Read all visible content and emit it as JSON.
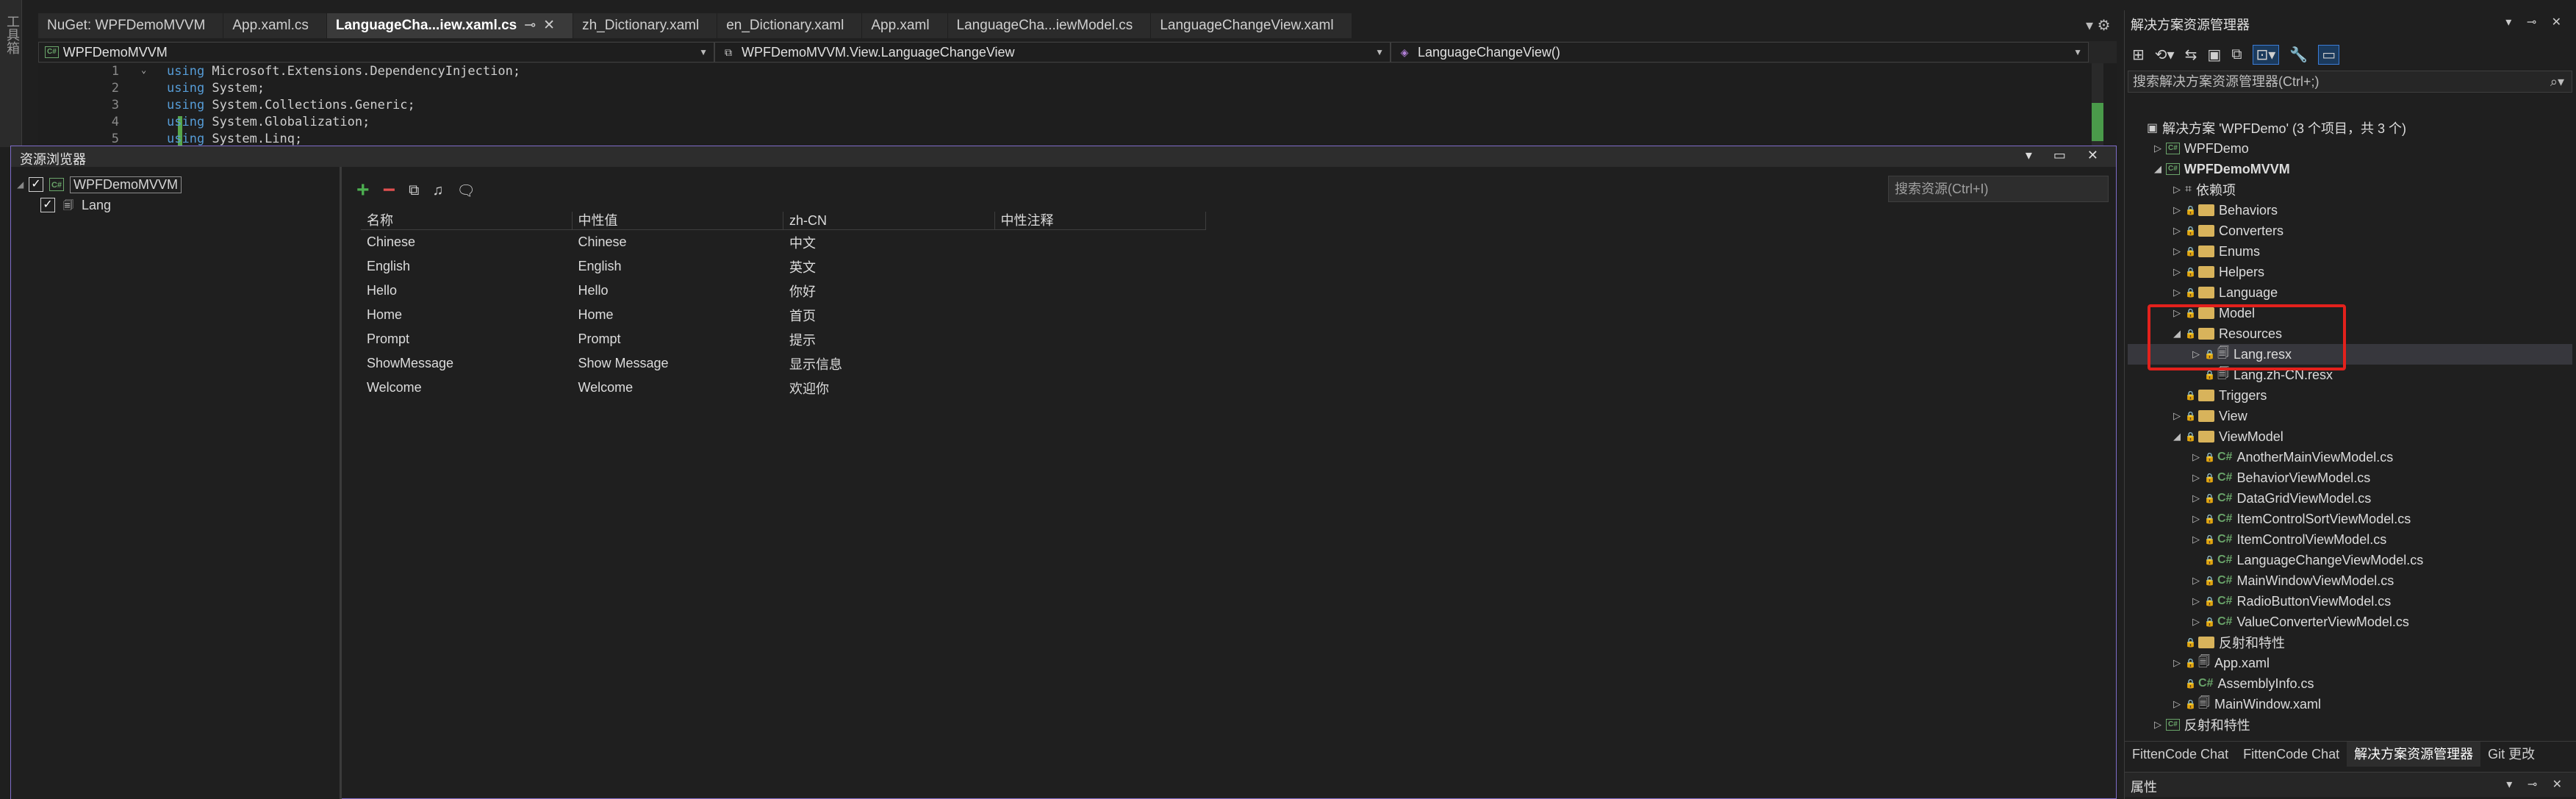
{
  "toolbox": {
    "label": "工具箱"
  },
  "tabs": [
    {
      "label": "NuGet: WPFDemoMVVM",
      "active": false
    },
    {
      "label": "App.xaml.cs",
      "active": false
    },
    {
      "label": "LanguageCha...iew.xaml.cs",
      "active": true
    },
    {
      "label": "zh_Dictionary.xaml",
      "active": false
    },
    {
      "label": "en_Dictionary.xaml",
      "active": false
    },
    {
      "label": "App.xaml",
      "active": false
    },
    {
      "label": "LanguageCha...iewModel.cs",
      "active": false
    },
    {
      "label": "LanguageChangeView.xaml",
      "active": false
    }
  ],
  "tab_pin_icon": "⊸",
  "tab_close_icon": "✕",
  "tabbar_overflow": "▾ ⚙",
  "navbar": {
    "project": "WPFDemoMVVM",
    "type": "WPFDemoMVVM.View.LanguageChangeView",
    "member": "LanguageChangeView()"
  },
  "code_lines": [
    {
      "num": "1",
      "kw": "using",
      "rest": " Microsoft.Extensions.DependencyInjection;"
    },
    {
      "num": "2",
      "kw": "using",
      "rest": " System;"
    },
    {
      "num": "3",
      "kw": "using",
      "rest": " System.Collections.Generic;"
    },
    {
      "num": "4",
      "kw": "using",
      "rest": " System.Globalization;"
    },
    {
      "num": "5",
      "kw": "using",
      "rest": " System.Linq;"
    }
  ],
  "resource_browser": {
    "title": "资源浏览器",
    "window_buttons": "▾ ▭ ✕",
    "tree": {
      "project": "WPFDemoMVVM",
      "child": "Lang"
    },
    "search_placeholder": "搜索资源(Ctrl+I)",
    "grid": {
      "headers": [
        "名称",
        "中性值",
        "zh-CN",
        "中性注释"
      ],
      "rows": [
        [
          "Chinese",
          "Chinese",
          "中文",
          ""
        ],
        [
          "English",
          "English",
          "英文",
          ""
        ],
        [
          "Hello",
          "Hello",
          "你好",
          ""
        ],
        [
          "Home",
          "Home",
          "首页",
          ""
        ],
        [
          "Prompt",
          "Prompt",
          "提示",
          ""
        ],
        [
          "ShowMessage",
          "Show Message",
          "显示信息",
          ""
        ],
        [
          "Welcome",
          "Welcome",
          "欢迎你",
          ""
        ]
      ]
    }
  },
  "solution_explorer": {
    "title": "解决方案资源管理器",
    "title_buttons": "▾ ⊸ ✕",
    "search_placeholder": "搜索解决方案资源管理器(Ctrl+;)",
    "items": [
      {
        "label": "解决方案 'WPFDemo' (3 个项目，共 3 个)",
        "indent": 0,
        "icon": "solution",
        "expander": ""
      },
      {
        "label": "WPFDemo",
        "indent": 1,
        "icon": "project",
        "expander": "▷"
      },
      {
        "label": "WPFDemoMVVM",
        "indent": 1,
        "icon": "project",
        "expander": "◢",
        "bold": true
      },
      {
        "label": "依赖项",
        "indent": 2,
        "icon": "ref",
        "expander": "▷"
      },
      {
        "label": "Behaviors",
        "indent": 2,
        "icon": "folder",
        "expander": "▷"
      },
      {
        "label": "Converters",
        "indent": 2,
        "icon": "folder",
        "expander": "▷"
      },
      {
        "label": "Enums",
        "indent": 2,
        "icon": "folder",
        "expander": "▷"
      },
      {
        "label": "Helpers",
        "indent": 2,
        "icon": "folder",
        "expander": "▷"
      },
      {
        "label": "Language",
        "indent": 2,
        "icon": "folder",
        "expander": "▷"
      },
      {
        "label": "Model",
        "indent": 2,
        "icon": "folder",
        "expander": "▷"
      },
      {
        "label": "Resources",
        "indent": 2,
        "icon": "folder",
        "expander": "◢"
      },
      {
        "label": "Lang.resx",
        "indent": 3,
        "icon": "file",
        "expander": "▷",
        "selected": true
      },
      {
        "label": "Lang.zh-CN.resx",
        "indent": 3,
        "icon": "file",
        "expander": ""
      },
      {
        "label": "Triggers",
        "indent": 2,
        "icon": "folder",
        "expander": ""
      },
      {
        "label": "View",
        "indent": 2,
        "icon": "folder",
        "expander": "▷"
      },
      {
        "label": "ViewModel",
        "indent": 2,
        "icon": "folder",
        "expander": "◢"
      },
      {
        "label": "AnotherMainViewModel.cs",
        "indent": 3,
        "icon": "cs",
        "expander": "▷"
      },
      {
        "label": "BehaviorViewModel.cs",
        "indent": 3,
        "icon": "cs",
        "expander": "▷"
      },
      {
        "label": "DataGridViewModel.cs",
        "indent": 3,
        "icon": "cs",
        "expander": "▷"
      },
      {
        "label": "ItemControlSortViewModel.cs",
        "indent": 3,
        "icon": "cs",
        "expander": "▷"
      },
      {
        "label": "ItemControlViewModel.cs",
        "indent": 3,
        "icon": "cs",
        "expander": "▷"
      },
      {
        "label": "LanguageChangeViewModel.cs",
        "indent": 3,
        "icon": "cs",
        "expander": ""
      },
      {
        "label": "MainWindowViewModel.cs",
        "indent": 3,
        "icon": "cs",
        "expander": "▷"
      },
      {
        "label": "RadioButtonViewModel.cs",
        "indent": 3,
        "icon": "cs",
        "expander": "▷"
      },
      {
        "label": "ValueConverterViewModel.cs",
        "indent": 3,
        "icon": "cs",
        "expander": "▷"
      },
      {
        "label": "反射和特性",
        "indent": 2,
        "icon": "folder",
        "expander": ""
      },
      {
        "label": "App.xaml",
        "indent": 2,
        "icon": "file",
        "expander": "▷"
      },
      {
        "label": "AssemblyInfo.cs",
        "indent": 2,
        "icon": "cs",
        "expander": ""
      },
      {
        "label": "MainWindow.xaml",
        "indent": 2,
        "icon": "file",
        "expander": "▷"
      },
      {
        "label": "反射和特性",
        "indent": 1,
        "icon": "project",
        "expander": "▷"
      }
    ],
    "bottom_tabs": [
      {
        "label": "FittenCode Chat",
        "active": false
      },
      {
        "label": "FittenCode Chat",
        "active": false
      },
      {
        "label": "解决方案资源管理器",
        "active": true
      },
      {
        "label": "Git 更改",
        "active": false
      }
    ],
    "properties_title": "属性",
    "properties_buttons": "▾ ⊸ ✕"
  },
  "colors": {
    "highlight_box": "#e3211c",
    "accent_border": "#7e6cc8",
    "keyword": "#569cd6",
    "csharp_icon": "#6aa56a",
    "folder_icon": "#d8b35b"
  }
}
